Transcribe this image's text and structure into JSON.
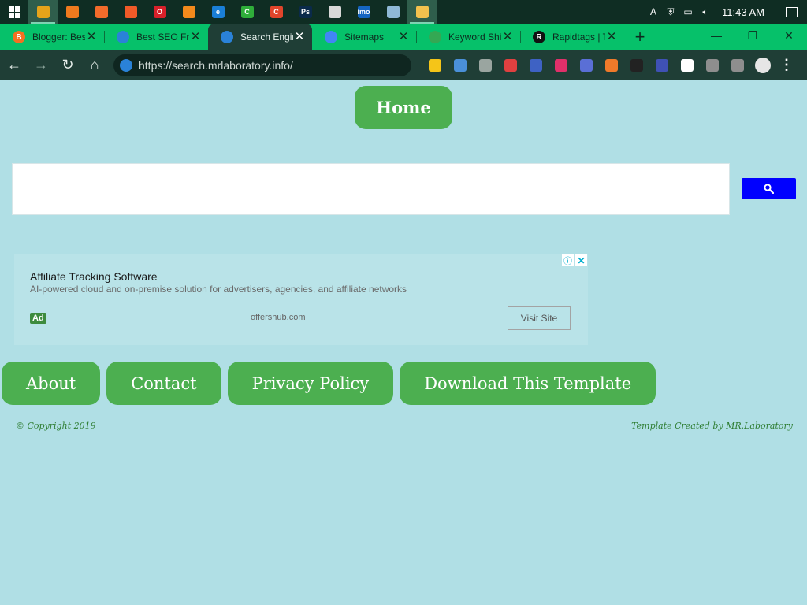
{
  "taskbar": {
    "apps": [
      {
        "name": "start-button"
      },
      {
        "name": "chrome",
        "color": "#e6a31a",
        "glyph": "",
        "active": true
      },
      {
        "name": "firefox",
        "color": "#f07a1e",
        "glyph": ""
      },
      {
        "name": "uc-browser",
        "color": "#f26b2b",
        "glyph": ""
      },
      {
        "name": "brave",
        "color": "#f05a28",
        "glyph": ""
      },
      {
        "name": "opera",
        "color": "#d8202a",
        "glyph": "O"
      },
      {
        "name": "firefox-alt",
        "color": "#f38a1c",
        "glyph": ""
      },
      {
        "name": "edge",
        "color": "#1a7fd6",
        "glyph": "e"
      },
      {
        "name": "camtasia",
        "color": "#2fae3a",
        "glyph": "C"
      },
      {
        "name": "camtasia-red",
        "color": "#e1452b",
        "glyph": "C"
      },
      {
        "name": "photoshop",
        "color": "#0a2a4a",
        "glyph": "Ps"
      },
      {
        "name": "terminal",
        "color": "#d8d8d8",
        "glyph": ""
      },
      {
        "name": "imo",
        "color": "#1565c0",
        "glyph": "imo"
      },
      {
        "name": "notepad",
        "color": "#8fb8d6",
        "glyph": ""
      },
      {
        "name": "file-explorer",
        "color": "#f2c14e",
        "glyph": "",
        "active": true
      }
    ],
    "clock": "11:43 AM"
  },
  "browser": {
    "tabs": [
      {
        "title": "Blogger: Best SEO",
        "icon_color": "#f37021",
        "icon_glyph": "B",
        "active": false
      },
      {
        "title": "Best SEO Friendly",
        "icon_color": "#2a82d8",
        "icon_glyph": "",
        "active": false
      },
      {
        "title": "Search Engine",
        "icon_color": "#2a82d8",
        "icon_glyph": "",
        "active": true
      },
      {
        "title": "Sitemaps",
        "icon_color": "#4285f4",
        "icon_glyph": "",
        "active": false
      },
      {
        "title": "Keyword Shitter",
        "icon_color": "#34a853",
        "icon_glyph": "",
        "active": false
      },
      {
        "title": "Rapidtags | The",
        "icon_color": "#111111",
        "icon_glyph": "R",
        "active": false
      }
    ],
    "url": "https://search.mrlaboratory.info/",
    "extensions": [
      "#f5c518",
      "#4a90d9",
      "#9aa5a0",
      "#e04040",
      "#3e62c4",
      "#e0306a",
      "#5a6fd6",
      "#f07a2a",
      "#222222",
      "#3f51b5",
      "#ffffff",
      "#8e8e8e",
      "#8e8e8e"
    ]
  },
  "page": {
    "home_label": "Home",
    "search": {
      "placeholder": "",
      "button_icon": "search-icon"
    },
    "ad": {
      "title": "Affiliate Tracking Software",
      "description": "AI-powered cloud and on-premise solution for advertisers, agencies, and affiliate networks",
      "badge": "Ad",
      "domain": "offershub.com",
      "cta": "Visit Site",
      "info_glyph": "ⓘ",
      "close_glyph": "✕"
    },
    "links": [
      "About",
      "Contact",
      "Privacy Policy",
      "Download This Template"
    ],
    "copyright": "© Copyright 2019",
    "credit": "Template Created by MR.Laboratory"
  },
  "colors": {
    "page_bg": "#b0dfe5",
    "button_green": "#4caf50",
    "search_blue": "#0000ff",
    "tab_strip": "#06c16a",
    "toolbar": "#1f3e36"
  }
}
